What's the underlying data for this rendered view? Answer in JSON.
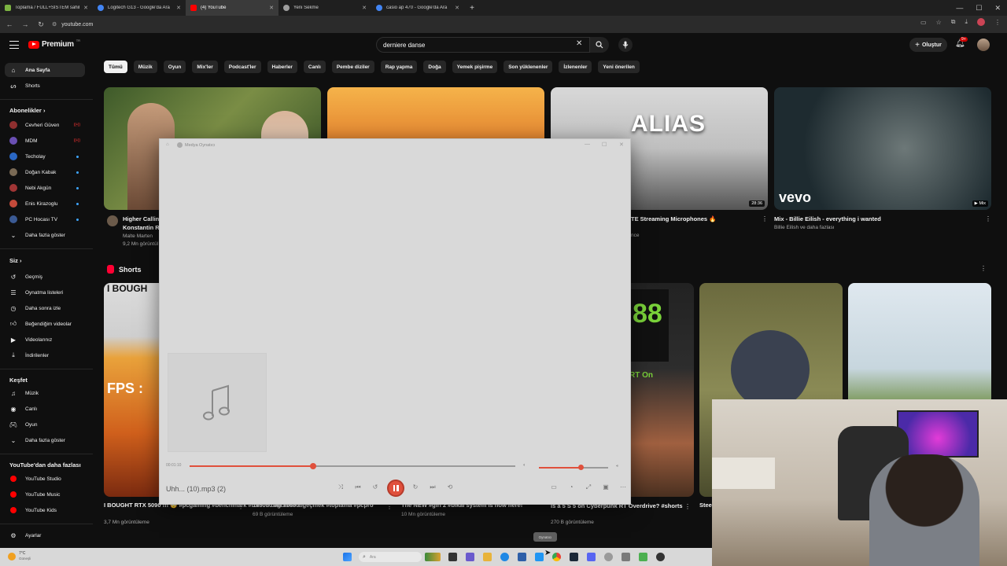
{
  "browser": {
    "tabs": [
      {
        "title": "Toplama / FULL+SİSTEM sahibi",
        "color": "#7cb342",
        "active": false
      },
      {
        "title": "Logitech G13 - Google'da Ara",
        "color": "#4285f4",
        "active": false
      },
      {
        "title": "(4) YouTube",
        "color": "#ff0000",
        "active": true
      },
      {
        "title": "Yeni Sekme",
        "color": "#9e9e9e",
        "active": false
      },
      {
        "title": "casio ap 470 - Google'da Ara",
        "color": "#4285f4",
        "active": false
      }
    ],
    "new_tab": "+",
    "url": "youtube.com"
  },
  "header": {
    "logo_text": "Premium",
    "logo_sup": "TR",
    "search_value": "derniere danse",
    "create_label": "Oluştur",
    "notification_count": "9+"
  },
  "chips": [
    "Tümü",
    "Müzik",
    "Oyun",
    "Mix'ler",
    "Podcast'ler",
    "Haberler",
    "Canlı",
    "Pembe diziler",
    "Rap yapma",
    "Doğa",
    "Yemek pişirme",
    "Son yüklenenler",
    "İzlenenler",
    "Yeni önerilen"
  ],
  "sidebar": {
    "home": "Ana Sayfa",
    "shorts": "Shorts",
    "subs_heading": "Abonelikler",
    "subscriptions": [
      {
        "name": "Cevheri Güven",
        "color": "#8e2f2f",
        "state": "live"
      },
      {
        "name": "MDM",
        "color": "#6a4fb3",
        "state": "live"
      },
      {
        "name": "Techolay",
        "color": "#2a67c4",
        "state": "dot"
      },
      {
        "name": "Doğan Kabak",
        "color": "#7a6a55",
        "state": "dot"
      },
      {
        "name": "Nebi Akgün",
        "color": "#a03535",
        "state": "dot"
      },
      {
        "name": "Enis Kirazoglu",
        "color": "#c44a3a",
        "state": "dot"
      },
      {
        "name": "PC Hocası TV",
        "color": "#3b5a94",
        "state": "dot"
      }
    ],
    "show_more": "Daha fazla göster",
    "you_heading": "Siz",
    "you_items": [
      "Geçmiş",
      "Oynatma listeleri",
      "Daha sonra izle",
      "Beğendiğim videolar",
      "Videolarınız",
      "İndirilenler"
    ],
    "explore_heading": "Keşfet",
    "explore_items": [
      "Müzik",
      "Canlı",
      "Oyun"
    ],
    "explore_more": "Daha fazla göster",
    "more_heading": "YouTube'dan daha fazlası",
    "more_items": [
      "YouTube Studio",
      "YouTube Music",
      "YouTube Kids"
    ],
    "settings": "Ayarlar"
  },
  "videos": [
    {
      "title": "Higher Callin",
      "channel": "Konstantin R",
      "meta": "Malte Marten",
      "views": "9,2 Mn görüntül"
    },
    {
      "title": "",
      "channel": "",
      "meta": "",
      "views": ""
    },
    {
      "title": "TE Streaming Microphones 🔥",
      "channel": "",
      "meta": "nce",
      "views": "",
      "duration": "28:36",
      "thumb_text": "ALIAS"
    },
    {
      "title": "Mix - Billie Eilish - everything i wanted",
      "channel": "Billie Eilish ve daha fazlası",
      "meta": "",
      "views": "",
      "badge": "Mix",
      "thumb_text": "vevo"
    }
  ],
  "shorts": {
    "heading": "Shorts",
    "items": [
      {
        "title": "I BOUGHT RTX 5090 !!! 😳 #pcgaming #benchmark #rtx5050 #gtx1080ti",
        "views": "3,7 Mn görüntüleme",
        "thumb_text": "I BOUGH",
        "thumb_text2": "FPS :"
      },
      {
        "title": "1080ti dan 5080'e geçmek #toplama #pcpro",
        "views": "69 B görüntüleme"
      },
      {
        "title": "The NEW #giri 2 #bikal system is now here!",
        "views": "10 Mn görüntüleme"
      },
      {
        "title": "Is a 5 S 5 on Cyberpunk RT Overdrive? #shorts",
        "views": "270 B görüntüleme",
        "thumb_text": "88",
        "thumb_text2": "RT On"
      },
      {
        "title": "Stee",
        "views": ""
      },
      {
        "title": "",
        "views": ""
      }
    ]
  },
  "player": {
    "title": "Medya Oynatıcı",
    "current_time": "00:01:10",
    "track": "Uhh... (10).mp3 (2)",
    "progress": 0.38,
    "volume": 0.6
  },
  "taskbar": {
    "weather_temp": "7°C",
    "weather_desc": "Güneşli",
    "search_placeholder": "Ara",
    "tooltip": "Oynatıcı"
  }
}
